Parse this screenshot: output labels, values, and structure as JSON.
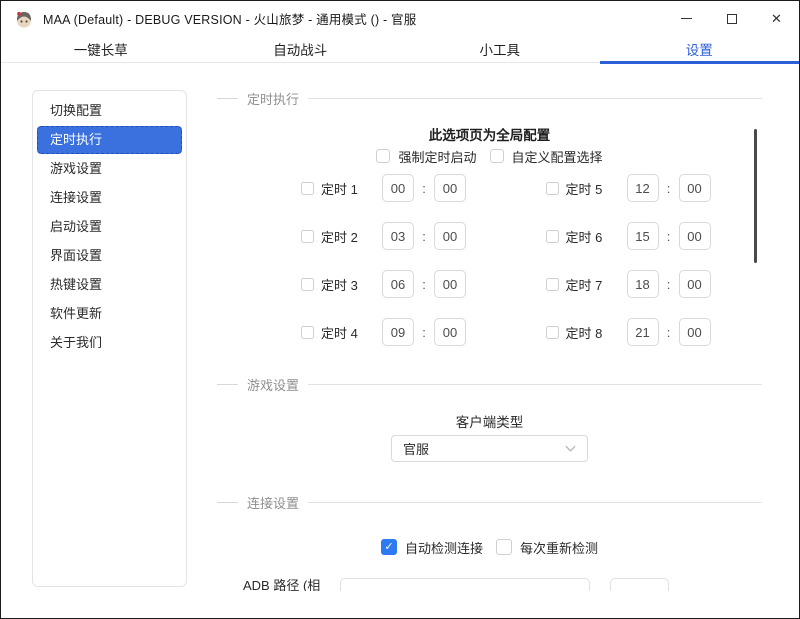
{
  "window": {
    "title": "MAA (Default) - DEBUG VERSION - 火山旅梦 - 通用模式 () - 官服",
    "close_glyph": "✕"
  },
  "tabs": [
    {
      "label": "一键长草",
      "active": false
    },
    {
      "label": "自动战斗",
      "active": false
    },
    {
      "label": "小工具",
      "active": false
    },
    {
      "label": "设置",
      "active": true
    }
  ],
  "sidebar": {
    "items": [
      {
        "label": "切换配置",
        "selected": false
      },
      {
        "label": "定时执行",
        "selected": true
      },
      {
        "label": "游戏设置",
        "selected": false
      },
      {
        "label": "连接设置",
        "selected": false
      },
      {
        "label": "启动设置",
        "selected": false
      },
      {
        "label": "界面设置",
        "selected": false
      },
      {
        "label": "热键设置",
        "selected": false
      },
      {
        "label": "软件更新",
        "selected": false
      },
      {
        "label": "关于我们",
        "selected": false
      }
    ]
  },
  "timer_section": {
    "header": "定时执行",
    "note": "此选项页为全局配置",
    "colon": ":",
    "options": [
      {
        "label": "强制定时启动",
        "checked": false
      },
      {
        "label": "自定义配置选择",
        "checked": false
      }
    ],
    "timers": [
      {
        "label": "定时 1",
        "hour": "00",
        "minute": "00",
        "checked": false
      },
      {
        "label": "定时 2",
        "hour": "03",
        "minute": "00",
        "checked": false
      },
      {
        "label": "定时 3",
        "hour": "06",
        "minute": "00",
        "checked": false
      },
      {
        "label": "定时 4",
        "hour": "09",
        "minute": "00",
        "checked": false
      },
      {
        "label": "定时 5",
        "hour": "12",
        "minute": "00",
        "checked": false
      },
      {
        "label": "定时 6",
        "hour": "15",
        "minute": "00",
        "checked": false
      },
      {
        "label": "定时 7",
        "hour": "18",
        "minute": "00",
        "checked": false
      },
      {
        "label": "定时 8",
        "hour": "21",
        "minute": "00",
        "checked": false
      }
    ]
  },
  "game_section": {
    "header": "游戏设置",
    "client_type_label": "客户端类型",
    "client_type_value": "官服"
  },
  "connection_section": {
    "header": "连接设置",
    "options": [
      {
        "label": "自动检测连接",
        "checked": true
      },
      {
        "label": "每次重新检测",
        "checked": false
      }
    ],
    "adb_path_label": "ADB 路径 (相"
  },
  "colors": {
    "accent_tab": "#2b5fd9",
    "accent_sidebar": "#3a71de",
    "accent_sidebar_border": "#1d4fc0",
    "accent_checkbox": "#2e7af2"
  }
}
